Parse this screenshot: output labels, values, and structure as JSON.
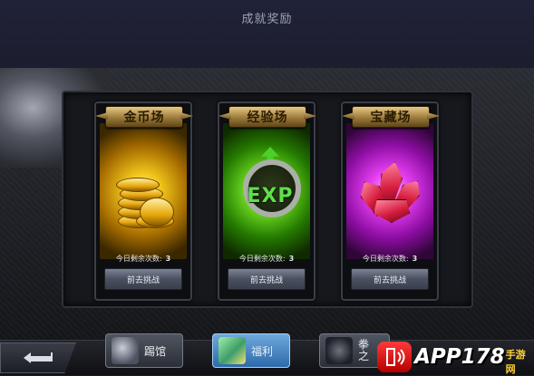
{
  "header": {
    "title": "成就奖励"
  },
  "cards": [
    {
      "name": "金币场",
      "remaining_label": "今日剩余次数:",
      "remaining_count": "3",
      "button": "前去挑战",
      "icon": "gold-coins-icon",
      "accent": "#f2c61b"
    },
    {
      "name": "经验场",
      "remaining_label": "今日剩余次数:",
      "remaining_count": "3",
      "button": "前去挑战",
      "icon": "exp-badge-icon",
      "accent": "#6fdc21",
      "badge_text": "EXP"
    },
    {
      "name": "宝藏场",
      "remaining_label": "今日剩余次数:",
      "remaining_count": "3",
      "button": "前去挑战",
      "icon": "red-crystal-icon",
      "accent": "#e53ff0"
    }
  ],
  "bottom_nav": {
    "back_icon": "return-arrow-icon",
    "items": [
      {
        "label": "踢馆",
        "icon": "fighter-portrait-icon"
      },
      {
        "label": "福利",
        "icon": "gift-pile-icon"
      },
      {
        "label_line1": "拳",
        "label_line2": "之",
        "icon": "dark-helmet-icon"
      }
    ]
  },
  "watermark": {
    "main": "APP178",
    "sub": "手游网"
  }
}
